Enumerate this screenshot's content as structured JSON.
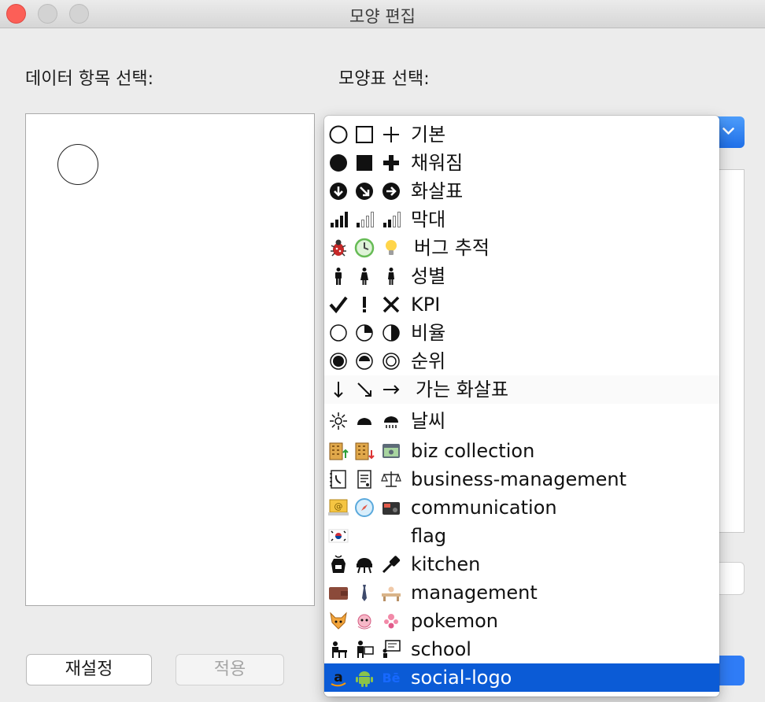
{
  "window": {
    "title": "모양 편집"
  },
  "labels": {
    "data_item": "데이터 항목 선택:",
    "palette": "모양표 선택:"
  },
  "buttons": {
    "reset": "재설정",
    "apply": "적용"
  },
  "menu": {
    "items": [
      {
        "label": "기본",
        "icons": [
          "circle-outline-icon",
          "square-outline-icon",
          "plus-icon"
        ]
      },
      {
        "label": "채워짐",
        "icons": [
          "circle-filled-icon",
          "square-filled-icon",
          "plus-filled-icon"
        ]
      },
      {
        "label": "화살표",
        "icons": [
          "arrow-down-circle-icon",
          "arrow-down-right-circle-icon",
          "arrow-right-circle-icon"
        ]
      },
      {
        "label": "막대",
        "icons": [
          "signal-bars-full-icon",
          "signal-bars-empty-icon",
          "signal-bars-half-icon"
        ]
      },
      {
        "label": "버그 추적",
        "icons": [
          "bug-icon",
          "clock-icon",
          "lightbulb-icon"
        ]
      },
      {
        "label": "성별",
        "icons": [
          "male-icon",
          "female-icon",
          "person-icon"
        ]
      },
      {
        "label": "KPI",
        "icons": [
          "checkmark-icon",
          "exclamation-icon",
          "x-mark-icon"
        ]
      },
      {
        "label": "비율",
        "icons": [
          "pie-empty-icon",
          "pie-quarter-icon",
          "pie-half-icon"
        ]
      },
      {
        "label": "순위",
        "icons": [
          "rank-filled-icon",
          "rank-half-icon",
          "rank-ring-icon"
        ]
      },
      {
        "label": "가는 화살표",
        "icons": [
          "thin-arrow-down-icon",
          "thin-arrow-down-right-icon",
          "thin-arrow-right-icon"
        ]
      },
      {
        "label": "날씨",
        "icons": [
          "sun-icon",
          "cloud-icon",
          "rain-icon"
        ]
      },
      {
        "label": "biz collection",
        "icons": [
          "building-up-icon",
          "building-down-icon",
          "cash-icon"
        ]
      },
      {
        "label": "business-management",
        "icons": [
          "address-book-icon",
          "document-icon",
          "scales-icon"
        ]
      },
      {
        "label": "communication",
        "icons": [
          "email-screen-icon",
          "compass-icon",
          "radio-icon"
        ]
      },
      {
        "label": "flag",
        "icons": [
          "korea-flag-icon"
        ]
      },
      {
        "label": "kitchen",
        "icons": [
          "apron-icon",
          "grill-icon",
          "spatula-icon"
        ]
      },
      {
        "label": "management",
        "icons": [
          "wallet-icon",
          "tie-icon",
          "desk-icon"
        ]
      },
      {
        "label": "pokemon",
        "icons": [
          "fox-icon",
          "pink-creature-icon",
          "flower-creature-icon"
        ]
      },
      {
        "label": "school",
        "icons": [
          "student-desk-icon",
          "teacher-icon",
          "chalkboard-icon"
        ]
      },
      {
        "label": "social-logo",
        "icons": [
          "amazon-logo-icon",
          "android-logo-icon",
          "behance-logo-icon"
        ],
        "selected": true
      }
    ],
    "selected_index": 19
  },
  "colors": {
    "accent": "#0b5bd6",
    "close": "#fc5f57"
  }
}
